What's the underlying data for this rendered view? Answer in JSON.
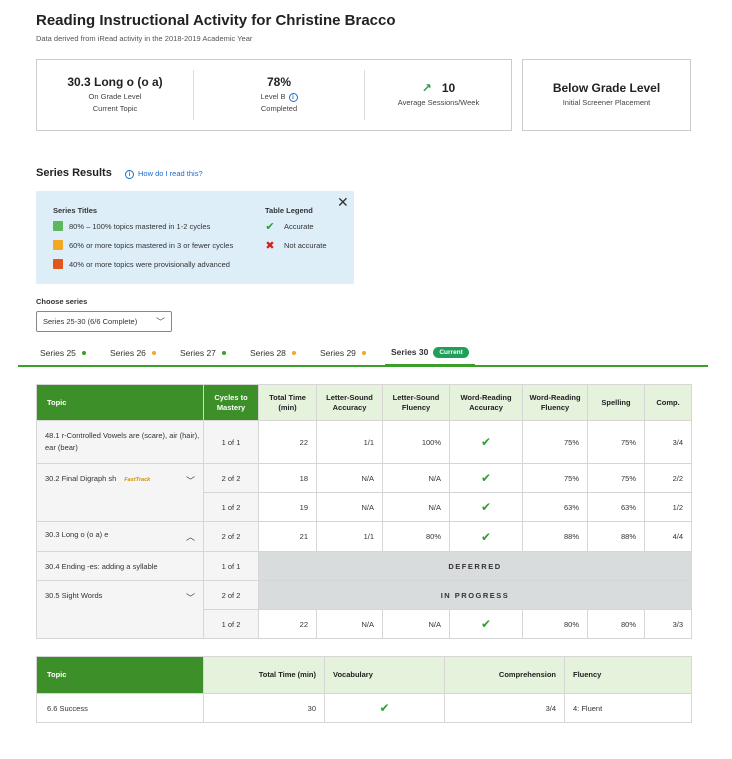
{
  "header": {
    "title": "Reading Instructional Activity for Christine Bracco",
    "subtitle": "Data derived from iRead activity in the 2018-2019 Academic Year"
  },
  "stats": {
    "topic": {
      "value": "30.3 Long o (o a)",
      "line1": "On Grade Level",
      "line2": "Current Topic"
    },
    "level": {
      "value": "78%",
      "line1": "Level B",
      "line2": "Completed"
    },
    "sessions": {
      "value": "10",
      "line1": "Average Sessions/Week"
    },
    "placement": {
      "value": "Below Grade Level",
      "line1": "Initial Screener Placement"
    }
  },
  "series_results": {
    "heading": "Series Results",
    "help_link": "How do I read this?",
    "legend": {
      "titles_heading": "Series Titles",
      "titles": [
        {
          "color": "#5cb85c",
          "label": "80% – 100% topics mastered in 1-2 cycles"
        },
        {
          "color": "#f5a623",
          "label": "60% or more topics mastered in 3 or fewer cycles"
        },
        {
          "color": "#e0561b",
          "label": "40% or more topics were provisionally advanced"
        }
      ],
      "table_heading": "Table Legend",
      "accurate": "Accurate",
      "not_accurate": "Not accurate"
    }
  },
  "choose_series": {
    "label": "Choose series",
    "value": "Series 25-30 (6/6 Complete)"
  },
  "tabs": [
    {
      "label": "Series 25",
      "dot": "#3aa02a"
    },
    {
      "label": "Series 26",
      "dot": "#f5a623"
    },
    {
      "label": "Series 27",
      "dot": "#3aa02a"
    },
    {
      "label": "Series 28",
      "dot": "#f5a623"
    },
    {
      "label": "Series 29",
      "dot": "#f5a623"
    },
    {
      "label": "Series 30",
      "badge": "Current"
    }
  ],
  "main_table": {
    "headers": [
      "Topic",
      "Cycles to Mastery",
      "Total Time (min)",
      "Letter-Sound Accuracy",
      "Letter-Sound Fluency",
      "Word-Reading Accuracy",
      "Word-Reading Fluency",
      "Spelling",
      "Comp."
    ],
    "rows": [
      {
        "topic": "48.1 r-Controlled Vowels are (scare), air (hair), ear (bear)",
        "cycles": "1 of 1",
        "time": "22",
        "lsa": "1/1",
        "lsf": "100%",
        "wra": "check",
        "wrf": "75%",
        "spell": "75%",
        "comp": "3/4"
      },
      {
        "topic": "30.2 Final Digraph sh",
        "tag": "FastTrack",
        "cycles": "2 of 2",
        "time": "18",
        "lsa": "N/A",
        "lsf": "N/A",
        "wra": "check",
        "wrf": "75%",
        "spell": "75%",
        "comp": "2/2"
      },
      {
        "topic": "",
        "cycles": "1 of 2",
        "time": "19",
        "lsa": "N/A",
        "lsf": "N/A",
        "wra": "check",
        "wrf": "63%",
        "spell": "63%",
        "comp": "1/2"
      },
      {
        "topic": "30.3  Long o (o a) e",
        "cycles": "2 of 2",
        "time": "21",
        "lsa": "1/1",
        "lsf": "80%",
        "wra": "check",
        "wrf": "88%",
        "spell": "88%",
        "comp": "4/4"
      },
      {
        "topic": "30.4 Ending -es: adding a syllable",
        "cycles": "1 of 1",
        "status": "DEFERRED"
      },
      {
        "topic": "30.5 Sight Words",
        "cycles": "2 of 2",
        "status": "IN PROGRESS"
      },
      {
        "topic": "",
        "cycles": "1 of 2",
        "time": "22",
        "lsa": "N/A",
        "lsf": "N/A",
        "wra": "check",
        "wrf": "80%",
        "spell": "80%",
        "comp": "3/3"
      }
    ]
  },
  "second_table": {
    "headers": [
      "Topic",
      "Total Time (min)",
      "Vocabulary",
      "Comprehension",
      "Fluency"
    ],
    "row": {
      "topic": "6.6 Success",
      "time": "30",
      "vocab": "check",
      "comp": "3/4",
      "fluency": "4: Fluent"
    }
  }
}
